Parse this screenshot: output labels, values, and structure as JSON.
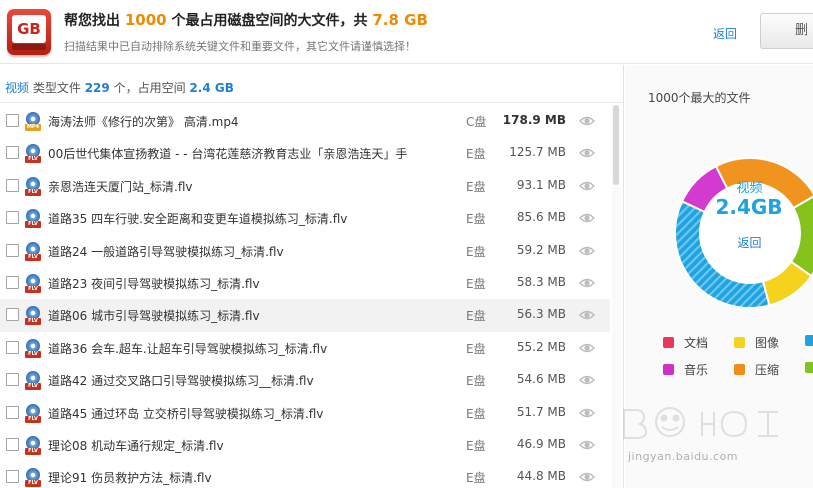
{
  "header": {
    "logo_text": "GB",
    "title_prefix": "帮您找出",
    "title_count": "1000",
    "title_middle": "个最占用磁盘空间的大文件，共",
    "title_total": "7.8 GB",
    "subtitle": "扫描结果中已自动排除系统关键文件和重要文件，其它文件请谨慎选择！",
    "back_label": "返回",
    "delete_label": "删"
  },
  "summary": {
    "category": "视频",
    "type_label": "类型文件",
    "count": "229",
    "count_unit": "个，占用空间",
    "size": "2.4 GB"
  },
  "files": [
    {
      "name": "海涛法师《修行的次第》 高清.mp4",
      "drive": "C盘",
      "size": "178.9 MB",
      "type": "MP4",
      "highlight": false
    },
    {
      "name": "00后世代集体宣扬教道 - - 台湾花莲慈济教育志业「亲恩浩连天」手",
      "drive": "E盘",
      "size": "125.7 MB",
      "type": "FLV",
      "highlight": false
    },
    {
      "name": "亲恩浩连天厦门站_标清.flv",
      "drive": "E盘",
      "size": "93.1 MB",
      "type": "FLV",
      "highlight": false
    },
    {
      "name": "道路35 四车行驶.安全距离和变更车道模拟练习_标清.flv",
      "drive": "E盘",
      "size": "85.6 MB",
      "type": "FLV",
      "highlight": false
    },
    {
      "name": "道路24 一般道路引导驾驶模拟练习_标清.flv",
      "drive": "E盘",
      "size": "59.2 MB",
      "type": "FLV",
      "highlight": false
    },
    {
      "name": "道路23 夜间引导驾驶模拟练习_标清.flv",
      "drive": "E盘",
      "size": "58.3 MB",
      "type": "FLV",
      "highlight": false
    },
    {
      "name": "道路06 城市引导驾驶模拟练习_标清.flv",
      "drive": "E盘",
      "size": "56.3 MB",
      "type": "FLV",
      "highlight": true
    },
    {
      "name": "道路36 会车.超车.让超车引导驾驶模拟练习_标清.flv",
      "drive": "E盘",
      "size": "55.2 MB",
      "type": "FLV",
      "highlight": false
    },
    {
      "name": "道路42 通过交叉路口引导驾驶模拟练习__标清.flv",
      "drive": "E盘",
      "size": "54.6 MB",
      "type": "FLV",
      "highlight": false
    },
    {
      "name": "道路45 通过环岛 立交桥引导驾驶模拟练习_标清.flv",
      "drive": "E盘",
      "size": "51.7 MB",
      "type": "FLV",
      "highlight": false
    },
    {
      "name": "理论08 机动车通行规定_标清.flv",
      "drive": "E盘",
      "size": "46.9 MB",
      "type": "FLV",
      "highlight": false
    },
    {
      "name": "理论91 伤员救护方法_标清.flv",
      "drive": "E盘",
      "size": "44.8 MB",
      "type": "FLV",
      "highlight": false
    }
  ],
  "right_panel": {
    "title": "1000个最大的文件",
    "center_label": "视频",
    "center_value": "2.4GB",
    "center_back": "返回",
    "legend": [
      {
        "label": "文档",
        "color": "#e8375a"
      },
      {
        "label": "图像",
        "color": "#f5d21b"
      },
      {
        "label": "音乐",
        "color": "#cf2fc4"
      },
      {
        "label": "压缩",
        "color": "#f48c18"
      }
    ]
  },
  "watermark": {
    "url_text": "jingyan.baidu.com"
  },
  "colors": {
    "accent_orange": "#f08a00",
    "link_blue": "#1e7ed8",
    "video_blue": "#1ea2e0",
    "ring_orange": "#f0931f",
    "ring_green": "#86c21c",
    "ring_magenta": "#d23ad0",
    "ring_blue": "#1ea2e0",
    "ring_yellow": "#f5d21b"
  }
}
